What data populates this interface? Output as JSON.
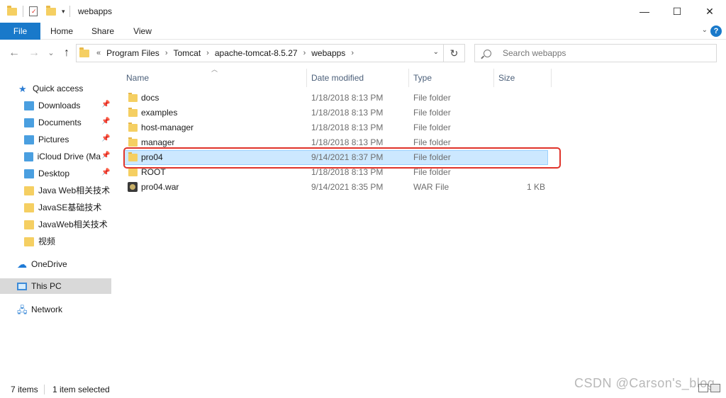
{
  "window": {
    "title": "webapps",
    "minimize": "—",
    "maximize": "☐",
    "close": "✕"
  },
  "ribbon": {
    "tabs": [
      "File",
      "Home",
      "Share",
      "View"
    ],
    "help": "?",
    "collapse_icon": "chevron-down-icon"
  },
  "nav": {
    "back": "←",
    "forward": "→",
    "recent": "⌄",
    "up": "↑"
  },
  "address": {
    "overflow": "«",
    "crumbs": [
      "Program Files",
      "Tomcat",
      "apache-tomcat-8.5.27",
      "webapps"
    ],
    "separator": "›",
    "dropdown": "⌄",
    "refresh": "↻"
  },
  "search": {
    "placeholder": "Search webapps"
  },
  "sidebar": {
    "quick_access": "Quick access",
    "items": [
      {
        "label": "Downloads",
        "icon": "downloads-icon",
        "pinned": true
      },
      {
        "label": "Documents",
        "icon": "documents-icon",
        "pinned": true
      },
      {
        "label": "Pictures",
        "icon": "pictures-icon",
        "pinned": true
      },
      {
        "label": "iCloud Drive (Ma",
        "icon": "icloud-icon",
        "pinned": true
      },
      {
        "label": "Desktop",
        "icon": "desktop-icon",
        "pinned": true
      },
      {
        "label": "Java Web相关技术",
        "icon": "folder-icon",
        "pinned": false
      },
      {
        "label": "JavaSE基础技术",
        "icon": "folder-icon",
        "pinned": false
      },
      {
        "label": "JavaWeb相关技术",
        "icon": "folder-icon",
        "pinned": false
      },
      {
        "label": "视频",
        "icon": "folder-icon",
        "pinned": false
      }
    ],
    "onedrive": "OneDrive",
    "this_pc": "This PC",
    "network": "Network",
    "pin_glyph": "📌"
  },
  "columns": {
    "name": "Name",
    "date": "Date modified",
    "type": "Type",
    "size": "Size"
  },
  "files": [
    {
      "name": "docs",
      "date": "1/18/2018 8:13 PM",
      "type": "File folder",
      "size": "",
      "kind": "folder",
      "selected": false
    },
    {
      "name": "examples",
      "date": "1/18/2018 8:13 PM",
      "type": "File folder",
      "size": "",
      "kind": "folder",
      "selected": false
    },
    {
      "name": "host-manager",
      "date": "1/18/2018 8:13 PM",
      "type": "File folder",
      "size": "",
      "kind": "folder",
      "selected": false
    },
    {
      "name": "manager",
      "date": "1/18/2018 8:13 PM",
      "type": "File folder",
      "size": "",
      "kind": "folder",
      "selected": false
    },
    {
      "name": "pro04",
      "date": "9/14/2021 8:37 PM",
      "type": "File folder",
      "size": "",
      "kind": "folder",
      "selected": true
    },
    {
      "name": "ROOT",
      "date": "1/18/2018 8:13 PM",
      "type": "File folder",
      "size": "",
      "kind": "folder",
      "selected": false
    },
    {
      "name": "pro04.war",
      "date": "9/14/2021 8:35 PM",
      "type": "WAR File",
      "size": "1 KB",
      "kind": "war",
      "selected": false
    }
  ],
  "status": {
    "count": "7 items",
    "selection": "1 item selected"
  },
  "watermark": "CSDN @Carson's_blog",
  "colors": {
    "accent": "#1979ca",
    "selection": "#cce8ff",
    "highlight_box": "#e0332a",
    "folder": "#f5cf62"
  }
}
